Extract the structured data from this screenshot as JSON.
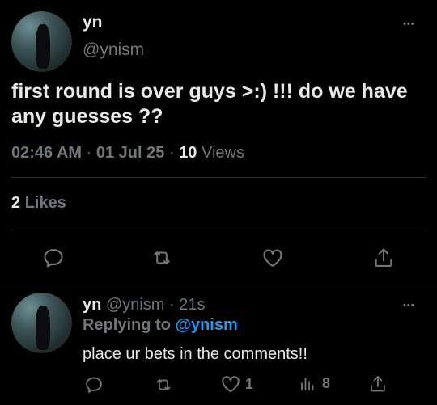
{
  "tweet": {
    "display_name": "yn",
    "handle": "@ynism",
    "more": "•••",
    "text": "first round is over guys >:) !!! do we have any guesses ??",
    "time": "02:46 AM",
    "sep1": "·",
    "date": "01 Jul 25",
    "sep2": "·",
    "views_count": "10",
    "views_label": "Views",
    "likes_count": "2",
    "likes_label": "Likes"
  },
  "reply": {
    "display_name": "yn",
    "handle": "@ynism",
    "sep": "·",
    "age": "21s",
    "more": "•••",
    "replying_label": "Replying to",
    "replying_handle": "@ynism",
    "text": "place ur bets in the comments!!",
    "like_count": "1",
    "views_count": "8"
  },
  "icons": [
    "comment-icon",
    "retweet-icon",
    "heart-icon",
    "share-icon",
    "views-icon"
  ],
  "colors": {
    "background": "#000000",
    "text": "#e7e9ea",
    "muted": "#71767b",
    "link": "#1d9bf0",
    "divider": "#2f3336"
  }
}
